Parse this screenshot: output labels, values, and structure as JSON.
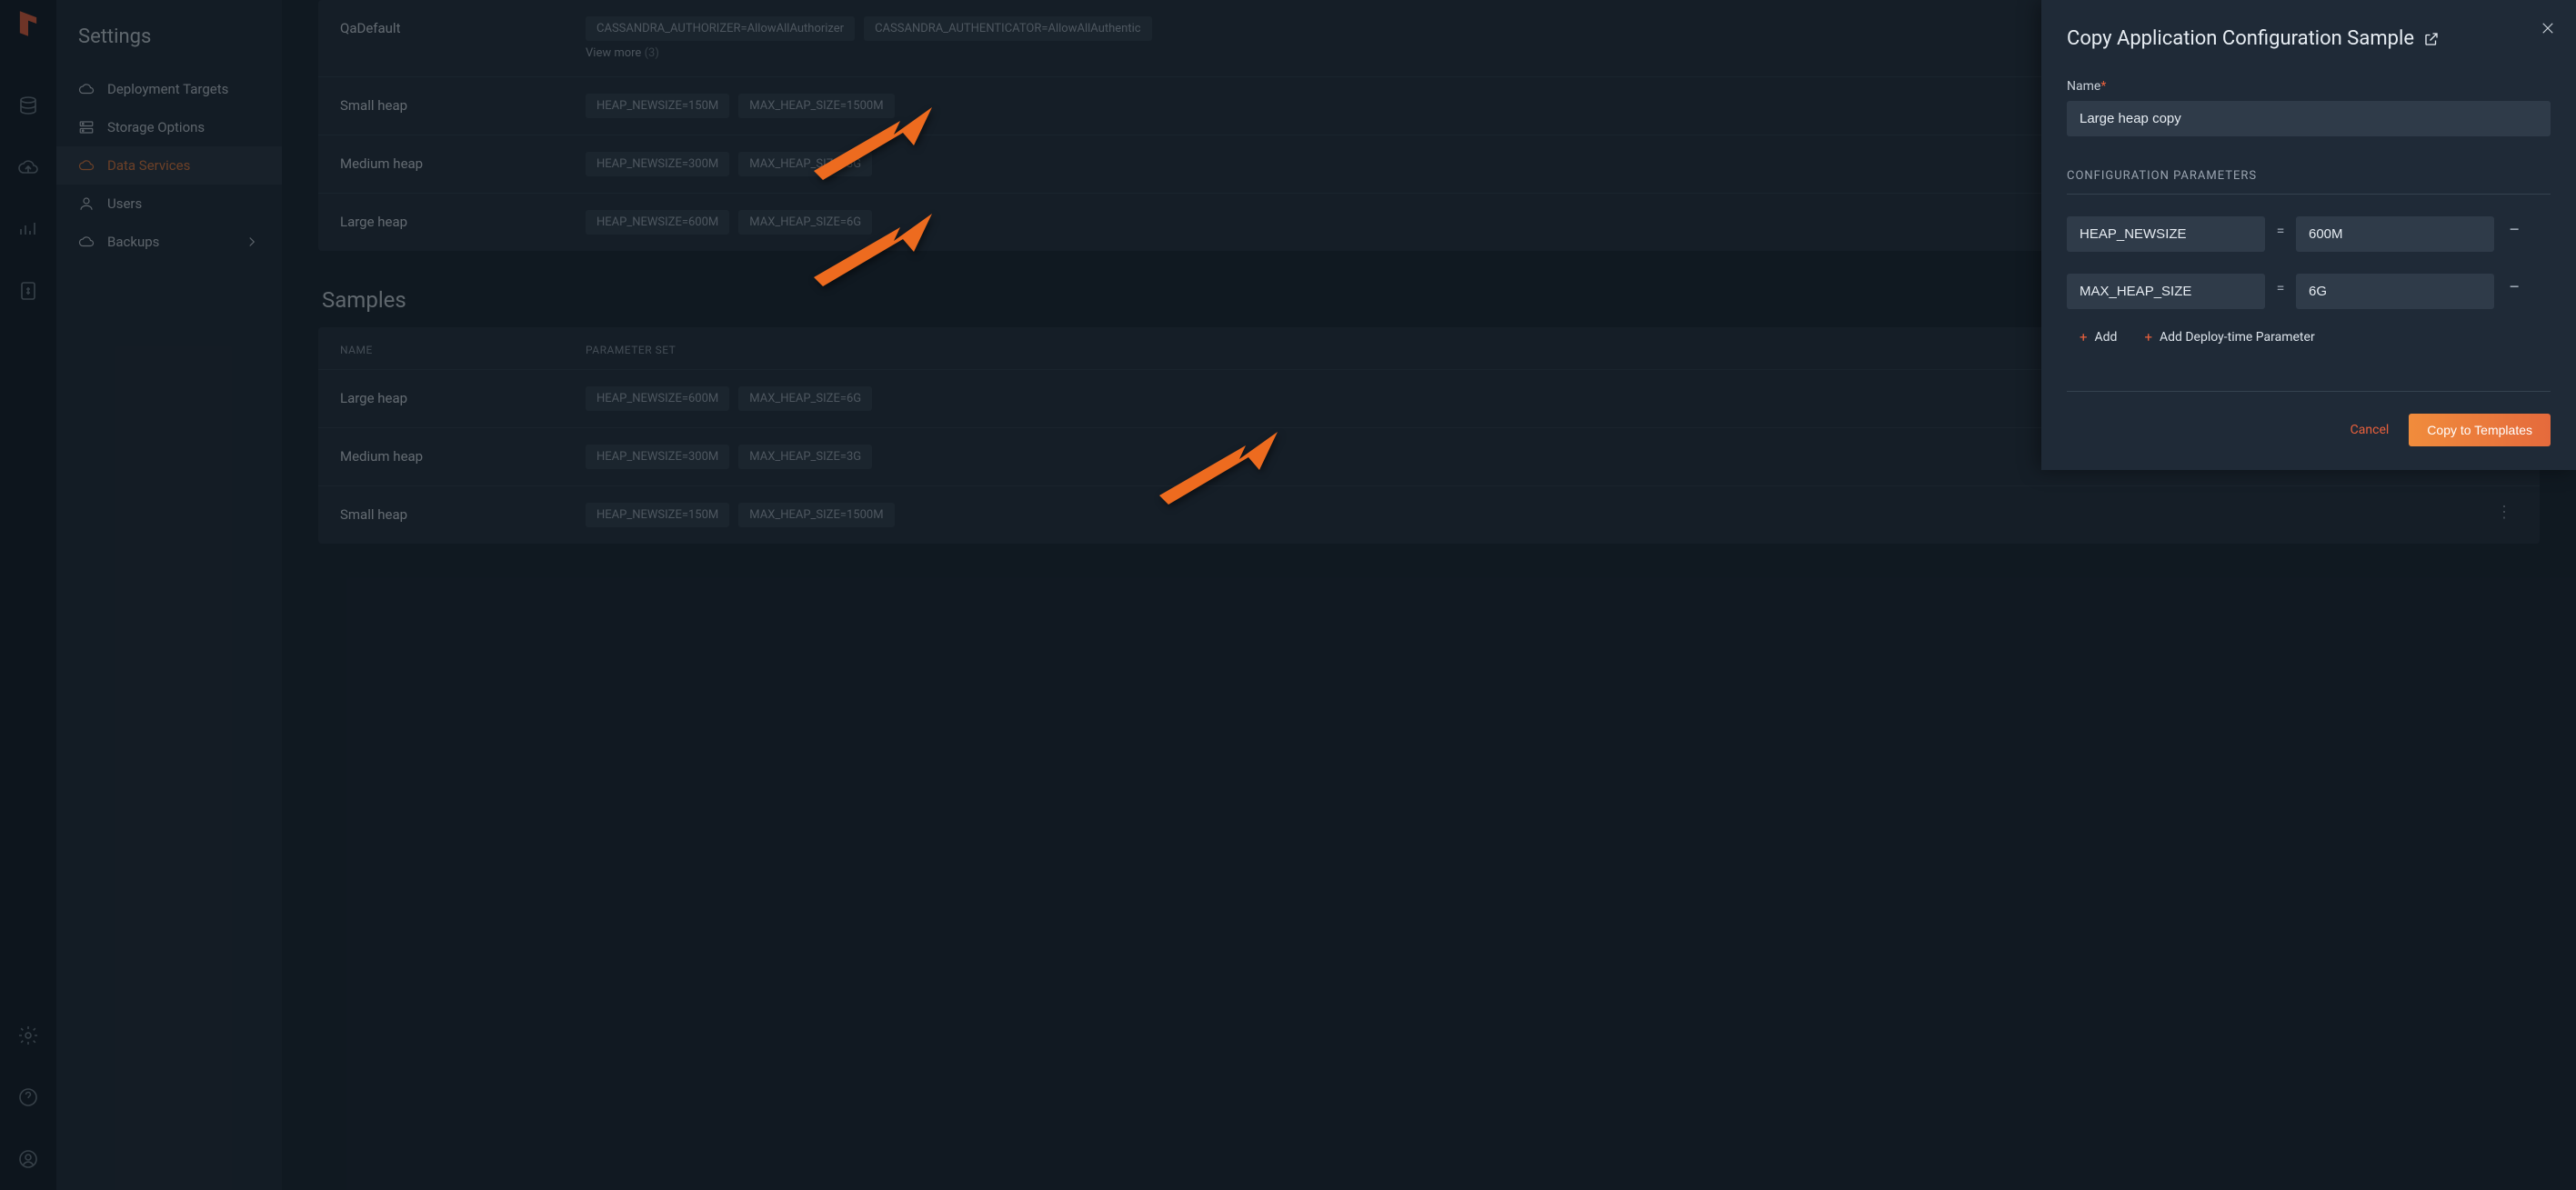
{
  "sidebar": {
    "title": "Settings",
    "items": [
      {
        "label": "Deployment Targets"
      },
      {
        "label": "Storage Options"
      },
      {
        "label": "Data Services"
      },
      {
        "label": "Users"
      },
      {
        "label": "Backups"
      }
    ]
  },
  "templates": {
    "rows": [
      {
        "name": "QaDefault",
        "tags": [
          "CASSANDRA_AUTHORIZER=AllowAllAuthorizer",
          "CASSANDRA_AUTHENTICATOR=AllowAllAuthentic"
        ],
        "view_more": "View more",
        "view_more_count": "(3)"
      },
      {
        "name": "Small heap",
        "tags": [
          "HEAP_NEWSIZE=150M",
          "MAX_HEAP_SIZE=1500M"
        ]
      },
      {
        "name": "Medium heap",
        "tags": [
          "HEAP_NEWSIZE=300M",
          "MAX_HEAP_SIZE=3G"
        ]
      },
      {
        "name": "Large heap",
        "tags": [
          "HEAP_NEWSIZE=600M",
          "MAX_HEAP_SIZE=6G"
        ]
      }
    ]
  },
  "samples": {
    "title": "Samples",
    "columns": {
      "name": "NAME",
      "params": "PARAMETER SET"
    },
    "rows": [
      {
        "name": "Large heap",
        "tags": [
          "HEAP_NEWSIZE=600M",
          "MAX_HEAP_SIZE=6G"
        ]
      },
      {
        "name": "Medium heap",
        "tags": [
          "HEAP_NEWSIZE=300M",
          "MAX_HEAP_SIZE=3G"
        ]
      },
      {
        "name": "Small heap",
        "tags": [
          "HEAP_NEWSIZE=150M",
          "MAX_HEAP_SIZE=1500M"
        ]
      }
    ]
  },
  "panel": {
    "title": "Copy Application Configuration Sample",
    "name_label": "Name",
    "name_value": "Large heap copy",
    "params_header": "CONFIGURATION PARAMETERS",
    "params": [
      {
        "key": "HEAP_NEWSIZE",
        "val": "600M"
      },
      {
        "key": "MAX_HEAP_SIZE",
        "val": "6G"
      }
    ],
    "add": "Add",
    "add_deploy": "Add Deploy-time Parameter",
    "cancel": "Cancel",
    "submit": "Copy to Templates"
  }
}
